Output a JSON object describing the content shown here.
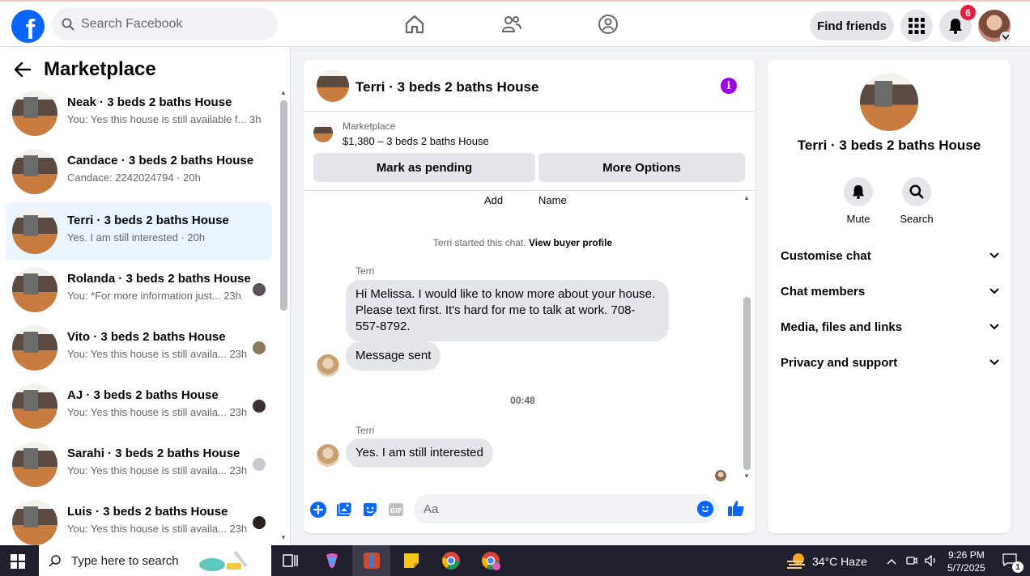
{
  "topnav": {
    "search_placeholder": "Search Facebook",
    "find_friends_label": "Find friends",
    "notification_count": "6",
    "brand_color": "#0866ff"
  },
  "sidebar": {
    "title": "Marketplace",
    "conversations": [
      {
        "name": "Neak · 3 beds 2 baths House",
        "preview": "You: Yes this house is still available f...",
        "time": "3h"
      },
      {
        "name": "Candace · 3 beds 2 baths House",
        "preview": "Candace: 2242024794",
        "time": "20h"
      },
      {
        "name": "Terri · 3 beds 2 baths House",
        "preview": "Yes. I am still interested",
        "time": "20h"
      },
      {
        "name": "Rolanda · 3 beds 2 baths House",
        "preview": "You: *For more information just...",
        "time": "23h"
      },
      {
        "name": "Vito · 3 beds 2 baths House",
        "preview": "You: Yes this house is still availa...",
        "time": "23h"
      },
      {
        "name": "AJ · 3 beds 2 baths House",
        "preview": "You: Yes this house is still availa...",
        "time": "23h"
      },
      {
        "name": "Sarahi · 3 beds 2 baths House",
        "preview": "You: Yes this house is still availa...",
        "time": "23h"
      },
      {
        "name": "Luis · 3 beds 2 baths House",
        "preview": "You: Yes this house is still availa...",
        "time": "23h"
      }
    ]
  },
  "chat": {
    "title": "Terri · 3 beds 2 baths House",
    "marketplace_label": "Marketplace",
    "price_line": "$1,380 – 3 beds 2 baths House",
    "mark_pending_label": "Mark as pending",
    "more_options_label": "More Options",
    "partial_add": "Add",
    "partial_name": "Name",
    "system_text": "Terri started this chat.",
    "system_link": "View buyer profile",
    "messages": [
      {
        "sender": "Terri",
        "text": "Hi Melissa. I would like to know more about your house. Please text first. It's hard for me to talk at work. 708-557-8792."
      },
      {
        "text": "Message sent"
      },
      {
        "sender": "Terri",
        "text": "Yes. I am still interested"
      }
    ],
    "time_separator": "00:48",
    "composer_placeholder": "Aa"
  },
  "details": {
    "title": "Terri · 3 beds 2 baths House",
    "mute_label": "Mute",
    "search_label": "Search",
    "sections": [
      "Customise chat",
      "Chat members",
      "Media, files and links",
      "Privacy and support"
    ]
  },
  "taskbar": {
    "search_placeholder": "Type here to search",
    "weather": "34°C  Haze",
    "time": "9:26 PM",
    "date": "5/7/2025",
    "notification_count": "1"
  }
}
